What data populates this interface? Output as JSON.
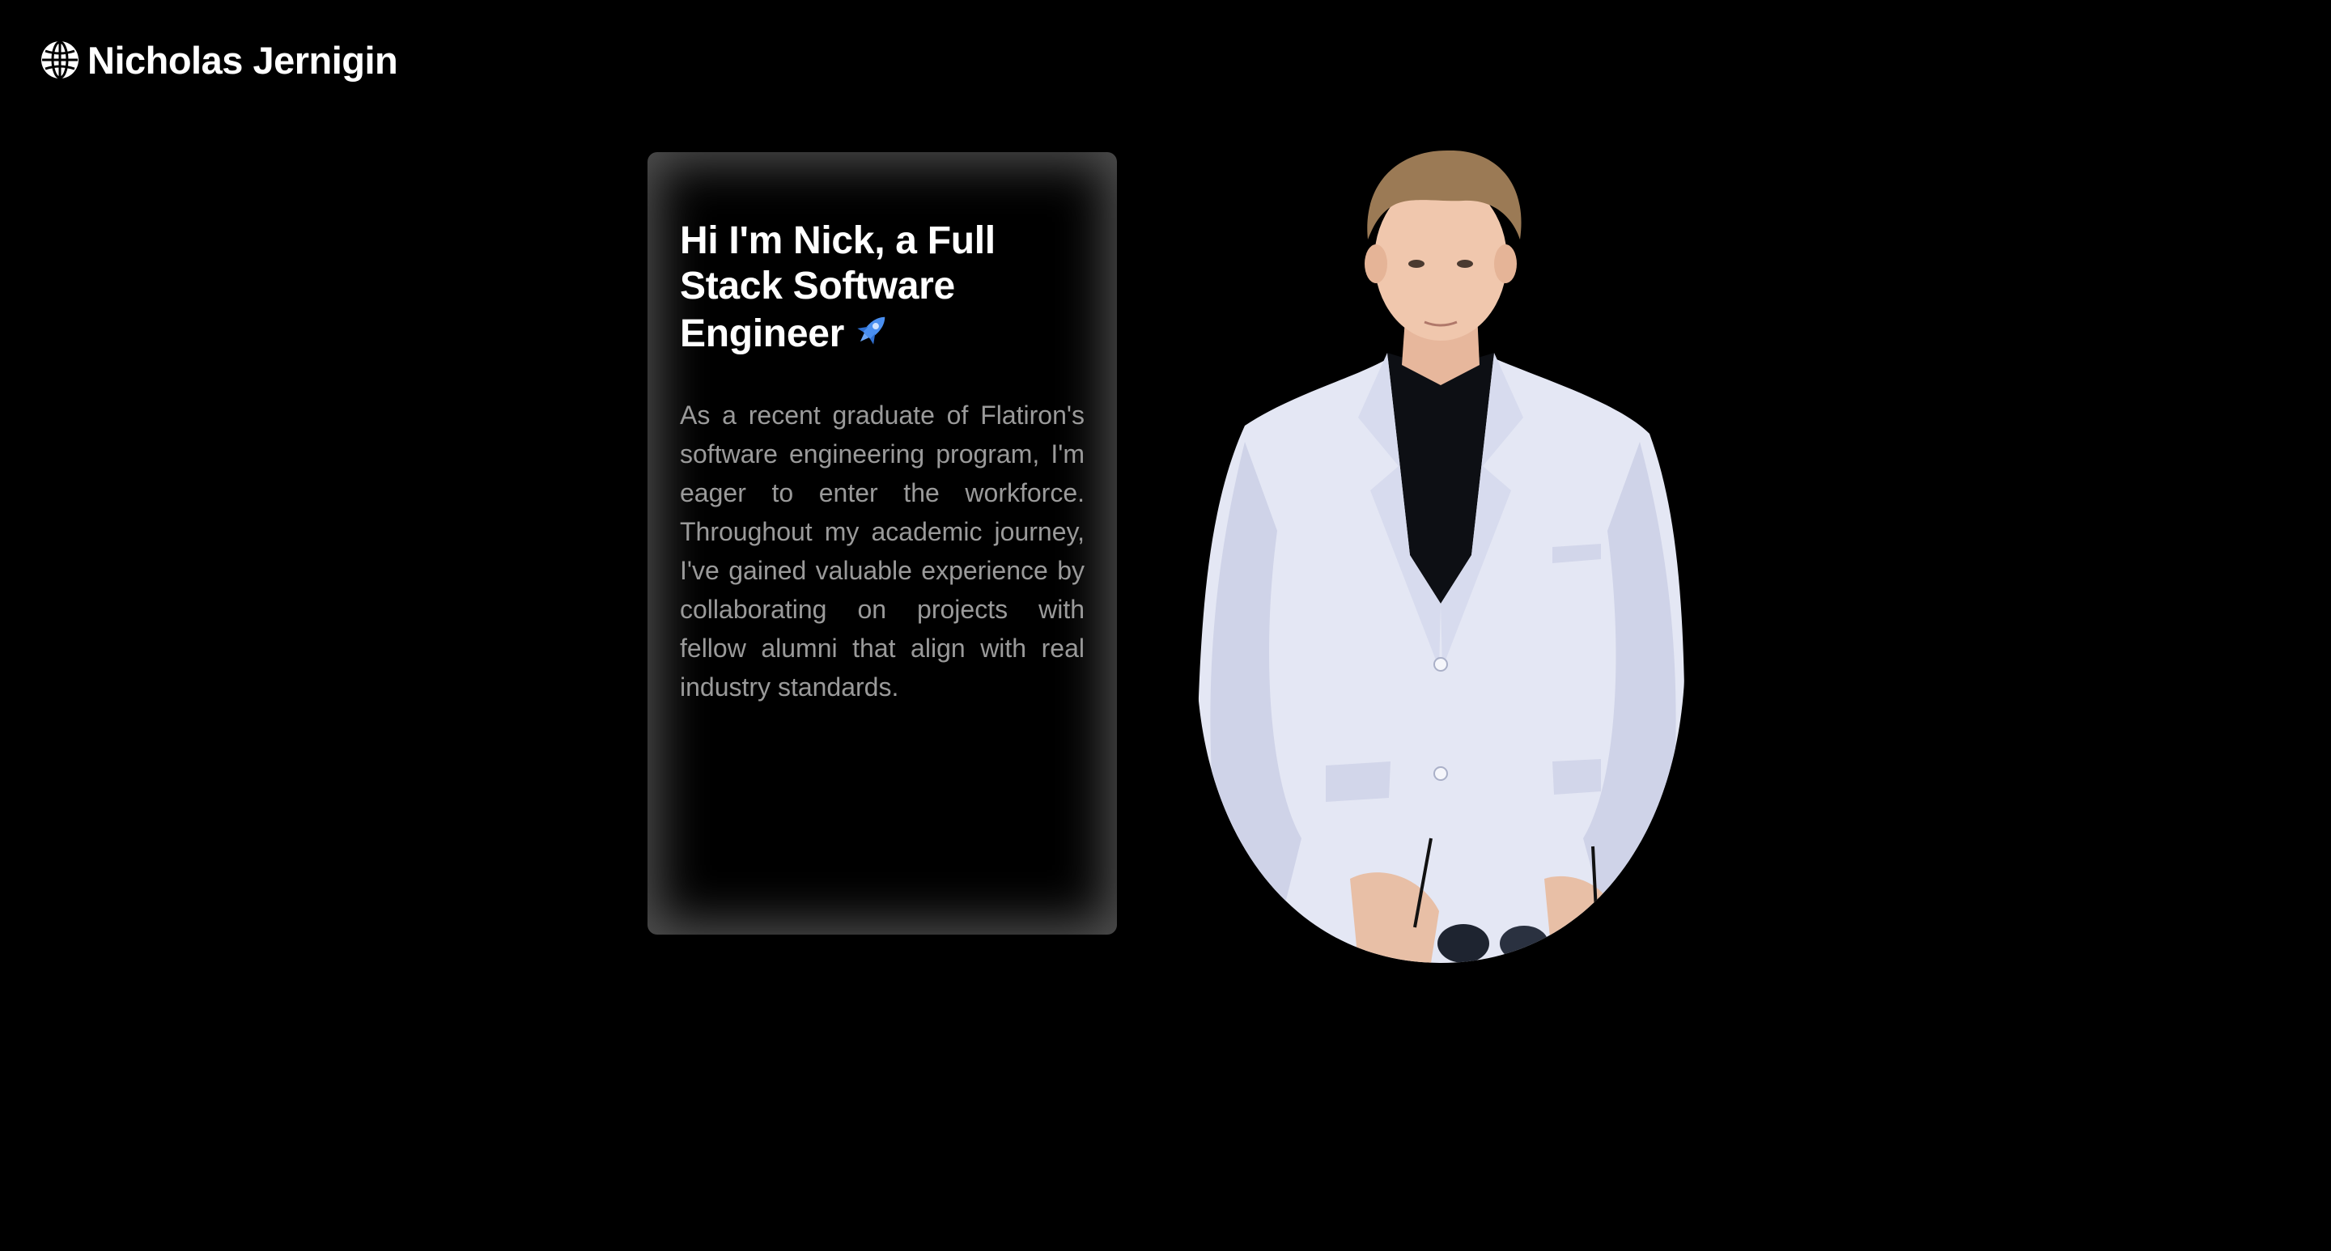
{
  "header": {
    "brand_icon": "globe-icon",
    "brand_name": "Nicholas Jernigin"
  },
  "intro": {
    "headline": "Hi I'm Nick, a Full Stack Software Engineer",
    "headline_icon": "rocket-icon",
    "bio": "As a recent graduate of Flatiron's software engineering program, I'm eager to enter the workforce. Throughout my academic journey, I've gained valuable experience by collaborating on projects with fellow alumni that align with real industry standards."
  },
  "portrait": {
    "subject": "profile-photo"
  },
  "colors": {
    "background": "#000000",
    "text": "#ffffff",
    "muted_text": "#9a9a9a",
    "accent": "#4a8ff0",
    "suit": "#e4e7f4"
  }
}
